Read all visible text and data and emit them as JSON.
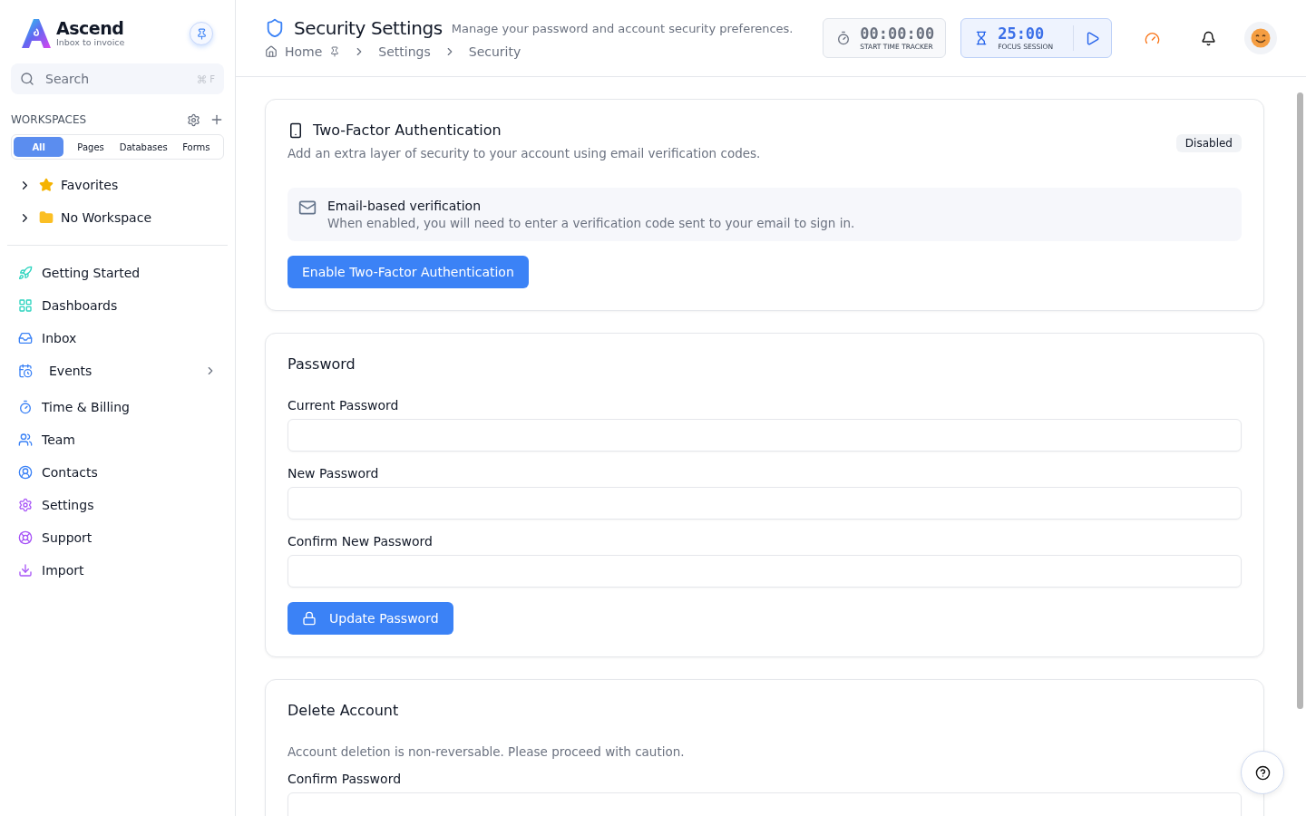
{
  "brand": {
    "name": "Ascend",
    "tagline": "Inbox to invoice"
  },
  "search": {
    "placeholder": "Search",
    "shortcut": "F"
  },
  "workspaces": {
    "title": "WORKSPACES",
    "filters": [
      {
        "label": "All",
        "selected": true
      },
      {
        "label": "Pages",
        "selected": false
      },
      {
        "label": "Databases",
        "selected": false
      },
      {
        "label": "Forms",
        "selected": false
      }
    ],
    "tree": [
      {
        "label": "Favorites",
        "expanded": false
      },
      {
        "label": "No Workspace",
        "expanded": false
      }
    ]
  },
  "nav": [
    {
      "label": "Getting Started",
      "kind": "link"
    },
    {
      "label": "Dashboards",
      "kind": "link"
    },
    {
      "label": "Inbox",
      "kind": "link"
    },
    {
      "label": "Events",
      "kind": "group"
    },
    {
      "label": "Time & Billing",
      "kind": "link"
    },
    {
      "label": "Team",
      "kind": "link"
    },
    {
      "label": "Contacts",
      "kind": "link"
    },
    {
      "label": "Settings",
      "kind": "link"
    },
    {
      "label": "Support",
      "kind": "link"
    },
    {
      "label": "Import",
      "kind": "link"
    }
  ],
  "header": {
    "title": "Security Settings",
    "subtitle": "Manage your password and account security preferences.",
    "breadcrumbs": [
      "Home",
      "Settings",
      "Security"
    ],
    "tracker": {
      "time": "00:00:00",
      "label": "START TIME TRACKER"
    },
    "focus": {
      "time": "25:00",
      "label": "FOCUS SESSION"
    }
  },
  "two_factor": {
    "title": "Two-Factor Authentication",
    "description": "Add an extra layer of security to your account using email verification codes.",
    "status": "Disabled",
    "enabled": false,
    "method": {
      "title": "Email-based verification",
      "description": "When enabled, you will need to enter a verification code sent to your email to sign in."
    },
    "button": "Enable Two-Factor Authentication"
  },
  "password": {
    "title": "Password",
    "fields": [
      {
        "label": "Current Password"
      },
      {
        "label": "New Password"
      },
      {
        "label": "Confirm New Password"
      }
    ],
    "button": "Update Password"
  },
  "delete_account": {
    "title": "Delete Account",
    "description": "Account deletion is non-reversable. Please proceed with caution.",
    "fields": [
      {
        "label": "Confirm Password"
      }
    ]
  }
}
